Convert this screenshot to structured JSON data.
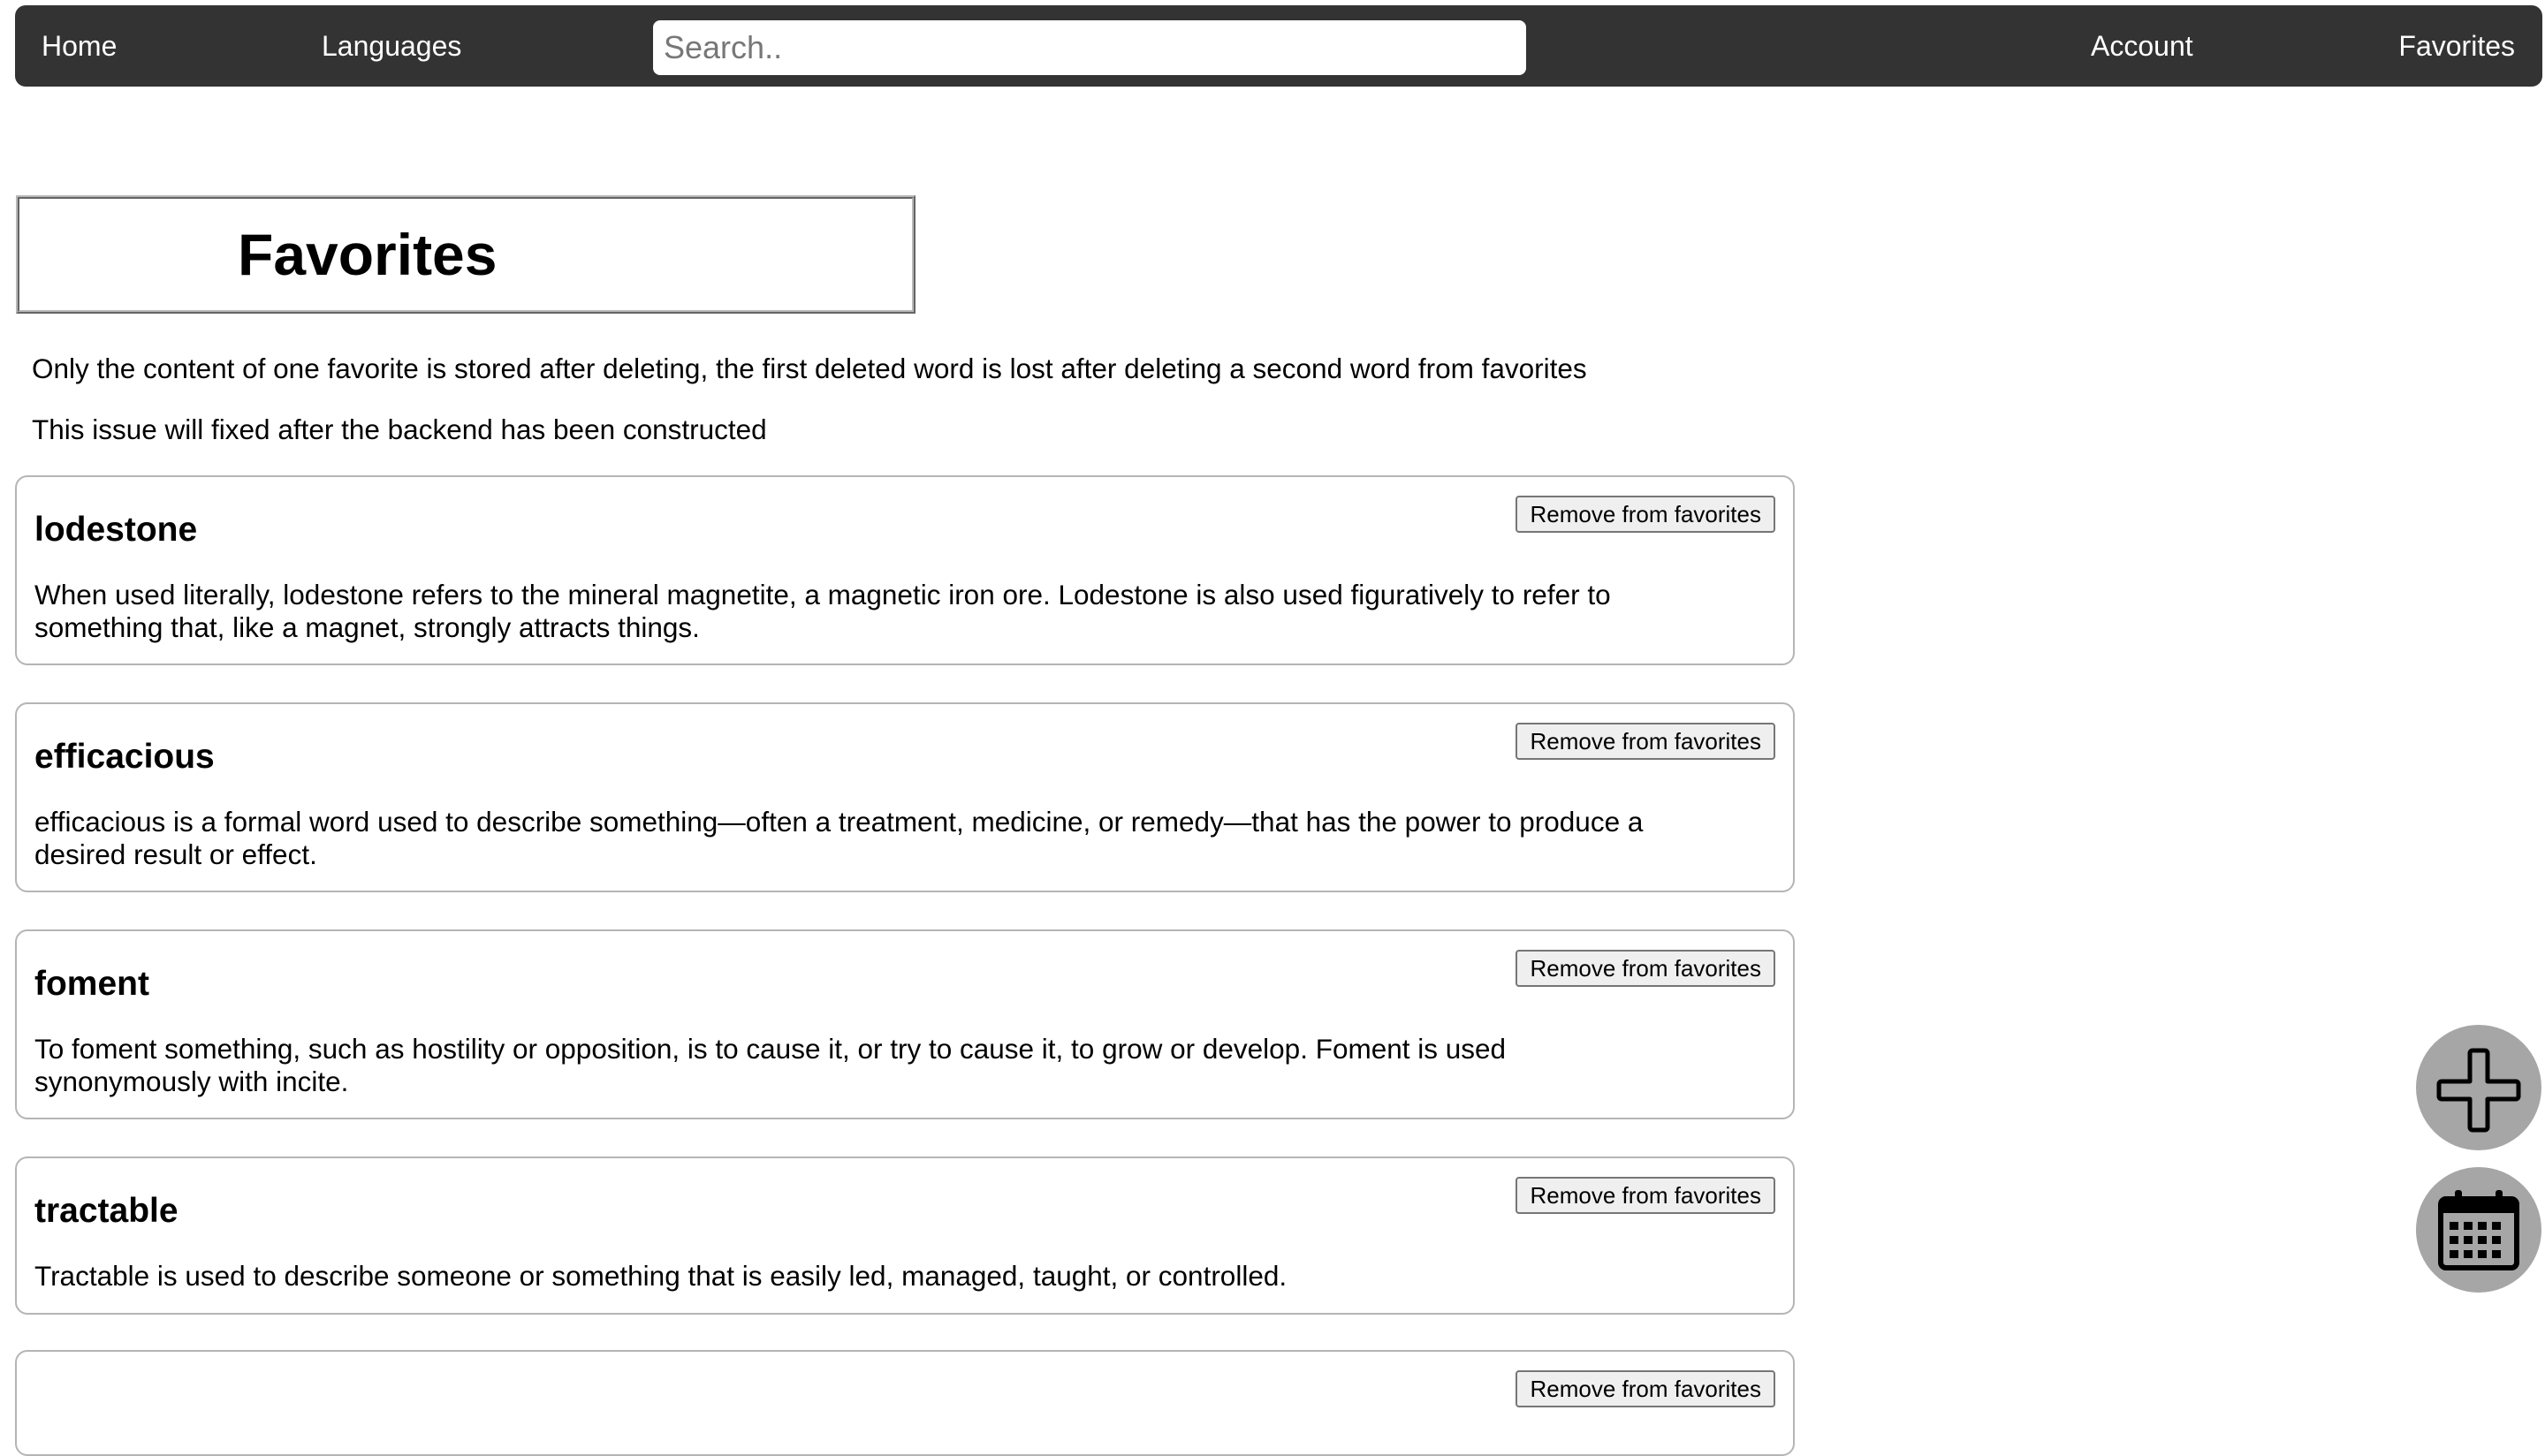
{
  "nav": {
    "home": "Home",
    "languages": "Languages",
    "search_placeholder": "Search..",
    "account": "Account",
    "favorites": "Favorites"
  },
  "page": {
    "title": "Favorites",
    "notes": [
      "Only the content of one favorite is stored after deleting, the first deleted word is lost after deleting a second word from favorites",
      "This issue will fixed after the backend has been constructed"
    ]
  },
  "favorites": [
    {
      "word": "lodestone",
      "definition": "When used literally, lodestone refers to the mineral magnetite, a magnetic iron ore. Lodestone is also used figuratively to refer to something that, like a magnet, strongly attracts things.",
      "remove_label": "Remove from favorites"
    },
    {
      "word": "efficacious",
      "definition": "efficacious is a formal word used to describe something—often a treatment, medicine, or remedy—that has the power to produce a desired result or effect.",
      "remove_label": "Remove from favorites"
    },
    {
      "word": "foment",
      "definition": "To foment something, such as hostility or opposition, is to cause it, or try to cause it, to grow or develop. Foment is used synonymously with incite.",
      "remove_label": "Remove from favorites"
    },
    {
      "word": "tractable",
      "definition": "Tractable is used to describe someone or something that is easily led, managed, taught, or controlled.",
      "remove_label": "Remove from favorites"
    },
    {
      "word": "",
      "definition": "",
      "remove_label": "Remove from favorites"
    }
  ],
  "floating_buttons": {
    "add_icon": "plus-icon",
    "calendar_icon": "calendar-icon"
  },
  "colors": {
    "navbar": "#333333",
    "fab": "#a6a6a6"
  }
}
